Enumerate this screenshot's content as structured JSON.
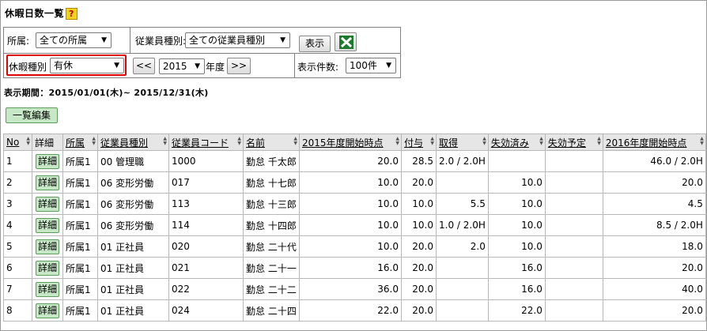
{
  "page": {
    "title": "休暇日数一覧",
    "help_label": "?"
  },
  "filters": {
    "dept_label": "所属:",
    "dept_value": "全ての所属",
    "emp_type_label": "従業員種別:",
    "emp_type_value": "全ての従業員種別",
    "show_button": "表示",
    "leave_type_label": "休暇種別",
    "leave_type_value": "有休",
    "prev_button": "<<",
    "year_value": "2015",
    "year_suffix": "年度",
    "next_button": ">>",
    "count_label": "表示件数:",
    "count_value": "100件"
  },
  "period_text": "表示期間：2015/01/01(木)~ 2015/12/31(木)",
  "bulk_edit_button": "一覧編集",
  "table": {
    "headers": [
      "No",
      "詳細",
      "所属",
      "従業員種別",
      "従業員コード",
      "名前",
      "2015年度開始時点",
      "付与",
      "取得",
      "失効済み",
      "失効予定",
      "2016年度開始時点"
    ],
    "detail_label": "詳細",
    "rows": [
      {
        "no": "1",
        "dept": "所属1",
        "type": "00 管理職",
        "code": "1000",
        "name": "勤怠 千太郎",
        "start": "20.0",
        "grant": "28.5",
        "taken": "2.0 / 2.0H",
        "expired": "",
        "to_expire": "",
        "next": "46.0 / 2.0H"
      },
      {
        "no": "2",
        "dept": "所属1",
        "type": "06 変形労働",
        "code": "017",
        "name": "勤怠 十七郎",
        "start": "10.0",
        "grant": "20.0",
        "taken": "",
        "expired": "10.0",
        "to_expire": "",
        "next": "20.0"
      },
      {
        "no": "3",
        "dept": "所属1",
        "type": "06 変形労働",
        "code": "113",
        "name": "勤怠 十三郎",
        "start": "10.0",
        "grant": "10.0",
        "taken": "5.5",
        "expired": "10.0",
        "to_expire": "",
        "next": "4.5"
      },
      {
        "no": "4",
        "dept": "所属1",
        "type": "06 変形労働",
        "code": "114",
        "name": "勤怠 十四郎",
        "start": "10.0",
        "grant": "10.0",
        "taken": "1.0 / 2.0H",
        "expired": "10.0",
        "to_expire": "",
        "next": "8.5 / 2.0H"
      },
      {
        "no": "5",
        "dept": "所属1",
        "type": "01 正社員",
        "code": "020",
        "name": "勤怠 二十代",
        "start": "10.0",
        "grant": "20.0",
        "taken": "2.0",
        "expired": "10.0",
        "to_expire": "",
        "next": "18.0"
      },
      {
        "no": "6",
        "dept": "所属1",
        "type": "01 正社員",
        "code": "021",
        "name": "勤怠 二十一",
        "start": "16.0",
        "grant": "20.0",
        "taken": "",
        "expired": "16.0",
        "to_expire": "",
        "next": "20.0"
      },
      {
        "no": "7",
        "dept": "所属1",
        "type": "01 正社員",
        "code": "022",
        "name": "勤怠 二十二",
        "start": "36.0",
        "grant": "20.0",
        "taken": "",
        "expired": "16.0",
        "to_expire": "",
        "next": "40.0"
      },
      {
        "no": "8",
        "dept": "所属1",
        "type": "01 正社員",
        "code": "024",
        "name": "勤怠 二十四",
        "start": "22.0",
        "grant": "20.0",
        "taken": "",
        "expired": "22.0",
        "to_expire": "",
        "next": "20.0"
      }
    ]
  }
}
